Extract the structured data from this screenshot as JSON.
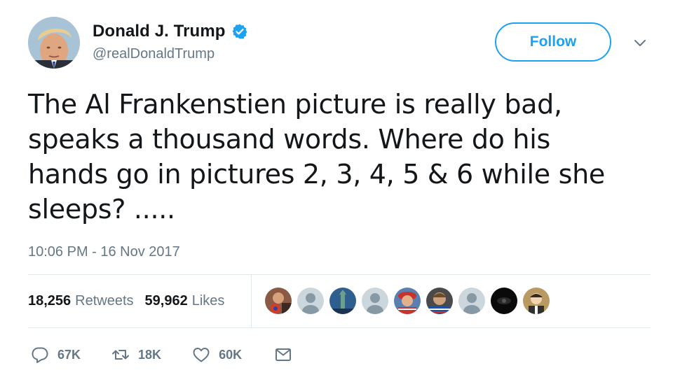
{
  "author": {
    "display_name": "Donald J. Trump",
    "handle": "@realDonaldTrump",
    "verified": true
  },
  "header": {
    "follow_label": "Follow"
  },
  "tweet": {
    "text": "The Al Frankenstien picture is really bad,\nspeaks a thousand words. Where do his\nhands go in pictures 2, 3, 4, 5 & 6 while she\nsleeps? .....",
    "timestamp": "10:06 PM - 16 Nov 2017"
  },
  "stats": {
    "retweets_count": "18,256",
    "retweets_label": "Retweets",
    "likes_count": "59,962",
    "likes_label": "Likes"
  },
  "actions": {
    "reply_count": "67K",
    "retweet_count": "18K",
    "like_count": "60K"
  },
  "colors": {
    "accent": "#1da1f2",
    "muted_text": "#657786",
    "divider": "#e1e8ed",
    "text": "#14171a"
  }
}
